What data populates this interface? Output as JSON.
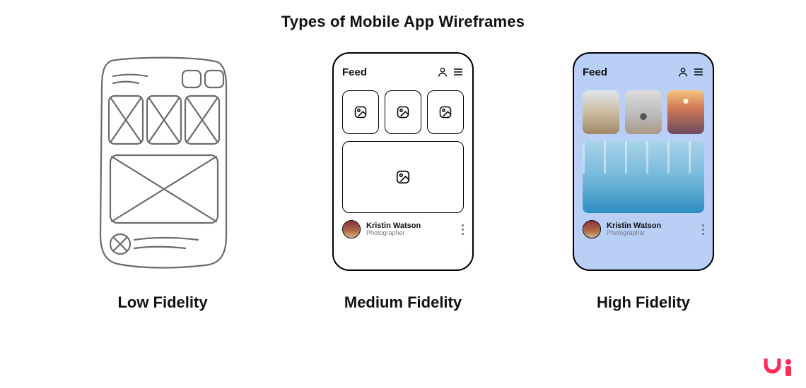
{
  "title": "Types of Mobile App Wireframes",
  "captions": {
    "low": "Low Fidelity",
    "med": "Medium Fidelity",
    "high": "High Fidelity"
  },
  "app": {
    "feed_label": "Feed",
    "author_name": "Kristin Watson",
    "author_role": "Photographer"
  },
  "icons": {
    "user": "user-icon",
    "menu": "menu-icon",
    "image": "image-icon",
    "more": "more-icon"
  },
  "colors": {
    "hf_bg": "#b9cff6",
    "brand": "#ff2d55"
  }
}
